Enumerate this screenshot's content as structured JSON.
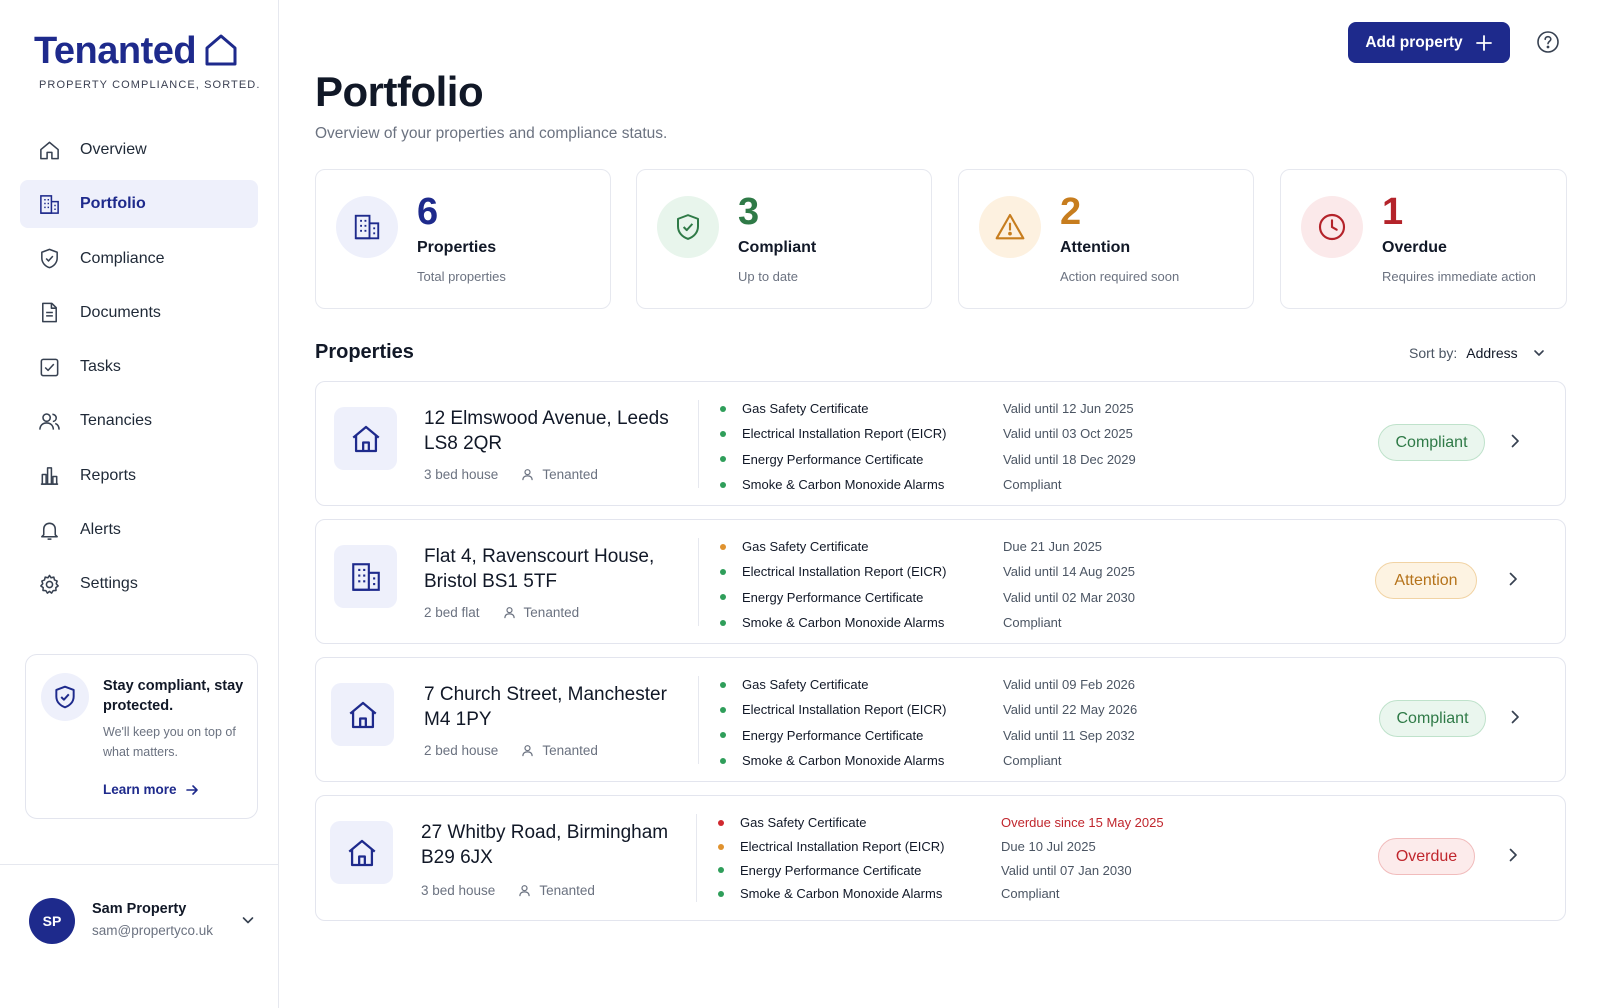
{
  "brand": {
    "name": "Tenanted",
    "tagline": "PROPERTY COMPLIANCE, SORTED."
  },
  "nav": [
    {
      "label": "Overview",
      "icon": "home-icon",
      "active": false
    },
    {
      "label": "Portfolio",
      "icon": "building-icon",
      "active": true
    },
    {
      "label": "Compliance",
      "icon": "shield-icon",
      "active": false
    },
    {
      "label": "Documents",
      "icon": "document-icon",
      "active": false
    },
    {
      "label": "Tasks",
      "icon": "checkbox-icon",
      "active": false
    },
    {
      "label": "Tenancies",
      "icon": "users-icon",
      "active": false
    },
    {
      "label": "Reports",
      "icon": "bar-chart-icon",
      "active": false
    },
    {
      "label": "Alerts",
      "icon": "bell-icon",
      "active": false
    },
    {
      "label": "Settings",
      "icon": "gear-icon",
      "active": false
    }
  ],
  "promo": {
    "title": "Stay compliant, stay protected.",
    "body": "We'll keep you on top of what matters.",
    "link": "Learn more"
  },
  "user": {
    "initials": "SP",
    "name": "Sam Property",
    "email": "sam@propertyco.uk"
  },
  "header": {
    "add_button": "Add property",
    "title": "Portfolio",
    "subtitle": "Overview of your properties and compliance status."
  },
  "stats": [
    {
      "value": "6",
      "label": "Properties",
      "desc": "Total properties",
      "color": "#1e2a8c",
      "bg": "#eef0fb"
    },
    {
      "value": "3",
      "label": "Compliant",
      "desc": "Up to date",
      "color": "#2f7a47",
      "bg": "#e8f5ec"
    },
    {
      "value": "2",
      "label": "Attention",
      "desc": "Action required soon",
      "color": "#c77d1e",
      "bg": "#fdf1e0"
    },
    {
      "value": "1",
      "label": "Overdue",
      "desc": "Requires immediate action",
      "color": "#b4232a",
      "bg": "#fbe9ea"
    }
  ],
  "properties_section": {
    "title": "Properties",
    "sort_label": "Sort by:",
    "sort_value": "Address"
  },
  "colors": {
    "ok": "#2f9e5a",
    "warn": "#e0922e",
    "bad": "#d0282f",
    "accent": "#1e2a8c"
  },
  "properties": [
    {
      "address": "12 Elmswood Avenue, Leeds LS8 2QR",
      "type": "3 bed house",
      "tenancy": "Tenanted",
      "icon": "house-icon",
      "status": "Compliant",
      "status_kind": "compliant",
      "certs": [
        {
          "name": "Gas Safety Certificate",
          "status": "Valid until 12 Jun 2025",
          "level": "ok"
        },
        {
          "name": "Electrical Installation Report (EICR)",
          "status": "Valid until 03 Oct 2025",
          "level": "ok"
        },
        {
          "name": "Energy Performance Certificate",
          "status": "Valid until 18 Dec 2029",
          "level": "ok"
        },
        {
          "name": "Smoke & Carbon Monoxide Alarms",
          "status": "Compliant",
          "level": "ok"
        }
      ]
    },
    {
      "address": "Flat 4, Ravenscourt House, Bristol BS1 5TF",
      "type": "2 bed flat",
      "tenancy": "Tenanted",
      "icon": "building-icon",
      "status": "Attention",
      "status_kind": "attention",
      "certs": [
        {
          "name": "Gas Safety Certificate",
          "status": "Due 21 Jun 2025",
          "level": "warn"
        },
        {
          "name": "Electrical Installation Report (EICR)",
          "status": "Valid until 14 Aug 2025",
          "level": "ok"
        },
        {
          "name": "Energy Performance Certificate",
          "status": "Valid until 02 Mar 2030",
          "level": "ok"
        },
        {
          "name": "Smoke & Carbon Monoxide Alarms",
          "status": "Compliant",
          "level": "ok"
        }
      ]
    },
    {
      "address": "7 Church Street, Manchester M4 1PY",
      "type": "2 bed house",
      "tenancy": "Tenanted",
      "icon": "house-icon",
      "status": "Compliant",
      "status_kind": "compliant",
      "certs": [
        {
          "name": "Gas Safety Certificate",
          "status": "Valid until 09 Feb 2026",
          "level": "ok"
        },
        {
          "name": "Electrical Installation Report (EICR)",
          "status": "Valid until 22 May 2026",
          "level": "ok"
        },
        {
          "name": "Energy Performance Certificate",
          "status": "Valid until 11 Sep 2032",
          "level": "ok"
        },
        {
          "name": "Smoke & Carbon Monoxide Alarms",
          "status": "Compliant",
          "level": "ok"
        }
      ]
    },
    {
      "address": "27 Whitby Road, Birmingham B29 6JX",
      "type": "3 bed house",
      "tenancy": "Tenanted",
      "icon": "house-icon",
      "status": "Overdue",
      "status_kind": "overdue",
      "certs": [
        {
          "name": "Gas Safety Certificate",
          "status": "Overdue since 15 May 2025",
          "level": "bad"
        },
        {
          "name": "Electrical Installation Report (EICR)",
          "status": "Due 10 Jul 2025",
          "level": "warn"
        },
        {
          "name": "Energy Performance Certificate",
          "status": "Valid until 07 Jan 2030",
          "level": "ok"
        },
        {
          "name": "Smoke & Carbon Monoxide Alarms",
          "status": "Compliant",
          "level": "ok"
        }
      ]
    }
  ]
}
